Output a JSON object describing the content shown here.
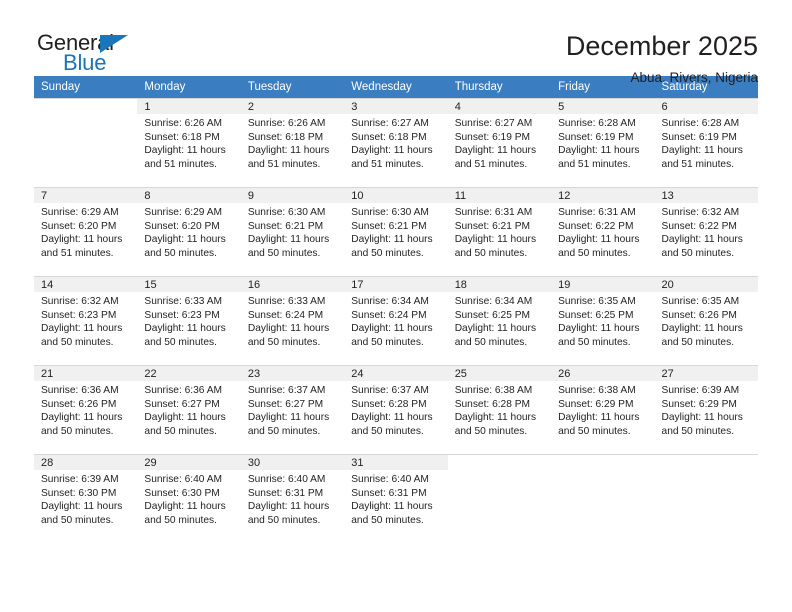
{
  "brand": {
    "name_part1": "General",
    "name_part2": "Blue",
    "triangle_color": "#1b75bb",
    "text_color": "#231f20"
  },
  "header": {
    "title": "December 2025",
    "subtitle": "Abua, Rivers, Nigeria",
    "header_bg": "#3a7dc0",
    "header_text": "#ffffff",
    "daynum_band_bg": "#f0f0f0"
  },
  "weekday_headers": [
    "Sunday",
    "Monday",
    "Tuesday",
    "Wednesday",
    "Thursday",
    "Friday",
    "Saturday"
  ],
  "weeks": [
    [
      {
        "day": "",
        "sunrise": "",
        "sunset": "",
        "daylight1": "",
        "daylight2": ""
      },
      {
        "day": "1",
        "sunrise": "Sunrise: 6:26 AM",
        "sunset": "Sunset: 6:18 PM",
        "daylight1": "Daylight: 11 hours",
        "daylight2": "and 51 minutes."
      },
      {
        "day": "2",
        "sunrise": "Sunrise: 6:26 AM",
        "sunset": "Sunset: 6:18 PM",
        "daylight1": "Daylight: 11 hours",
        "daylight2": "and 51 minutes."
      },
      {
        "day": "3",
        "sunrise": "Sunrise: 6:27 AM",
        "sunset": "Sunset: 6:18 PM",
        "daylight1": "Daylight: 11 hours",
        "daylight2": "and 51 minutes."
      },
      {
        "day": "4",
        "sunrise": "Sunrise: 6:27 AM",
        "sunset": "Sunset: 6:19 PM",
        "daylight1": "Daylight: 11 hours",
        "daylight2": "and 51 minutes."
      },
      {
        "day": "5",
        "sunrise": "Sunrise: 6:28 AM",
        "sunset": "Sunset: 6:19 PM",
        "daylight1": "Daylight: 11 hours",
        "daylight2": "and 51 minutes."
      },
      {
        "day": "6",
        "sunrise": "Sunrise: 6:28 AM",
        "sunset": "Sunset: 6:19 PM",
        "daylight1": "Daylight: 11 hours",
        "daylight2": "and 51 minutes."
      }
    ],
    [
      {
        "day": "7",
        "sunrise": "Sunrise: 6:29 AM",
        "sunset": "Sunset: 6:20 PM",
        "daylight1": "Daylight: 11 hours",
        "daylight2": "and 51 minutes."
      },
      {
        "day": "8",
        "sunrise": "Sunrise: 6:29 AM",
        "sunset": "Sunset: 6:20 PM",
        "daylight1": "Daylight: 11 hours",
        "daylight2": "and 50 minutes."
      },
      {
        "day": "9",
        "sunrise": "Sunrise: 6:30 AM",
        "sunset": "Sunset: 6:21 PM",
        "daylight1": "Daylight: 11 hours",
        "daylight2": "and 50 minutes."
      },
      {
        "day": "10",
        "sunrise": "Sunrise: 6:30 AM",
        "sunset": "Sunset: 6:21 PM",
        "daylight1": "Daylight: 11 hours",
        "daylight2": "and 50 minutes."
      },
      {
        "day": "11",
        "sunrise": "Sunrise: 6:31 AM",
        "sunset": "Sunset: 6:21 PM",
        "daylight1": "Daylight: 11 hours",
        "daylight2": "and 50 minutes."
      },
      {
        "day": "12",
        "sunrise": "Sunrise: 6:31 AM",
        "sunset": "Sunset: 6:22 PM",
        "daylight1": "Daylight: 11 hours",
        "daylight2": "and 50 minutes."
      },
      {
        "day": "13",
        "sunrise": "Sunrise: 6:32 AM",
        "sunset": "Sunset: 6:22 PM",
        "daylight1": "Daylight: 11 hours",
        "daylight2": "and 50 minutes."
      }
    ],
    [
      {
        "day": "14",
        "sunrise": "Sunrise: 6:32 AM",
        "sunset": "Sunset: 6:23 PM",
        "daylight1": "Daylight: 11 hours",
        "daylight2": "and 50 minutes."
      },
      {
        "day": "15",
        "sunrise": "Sunrise: 6:33 AM",
        "sunset": "Sunset: 6:23 PM",
        "daylight1": "Daylight: 11 hours",
        "daylight2": "and 50 minutes."
      },
      {
        "day": "16",
        "sunrise": "Sunrise: 6:33 AM",
        "sunset": "Sunset: 6:24 PM",
        "daylight1": "Daylight: 11 hours",
        "daylight2": "and 50 minutes."
      },
      {
        "day": "17",
        "sunrise": "Sunrise: 6:34 AM",
        "sunset": "Sunset: 6:24 PM",
        "daylight1": "Daylight: 11 hours",
        "daylight2": "and 50 minutes."
      },
      {
        "day": "18",
        "sunrise": "Sunrise: 6:34 AM",
        "sunset": "Sunset: 6:25 PM",
        "daylight1": "Daylight: 11 hours",
        "daylight2": "and 50 minutes."
      },
      {
        "day": "19",
        "sunrise": "Sunrise: 6:35 AM",
        "sunset": "Sunset: 6:25 PM",
        "daylight1": "Daylight: 11 hours",
        "daylight2": "and 50 minutes."
      },
      {
        "day": "20",
        "sunrise": "Sunrise: 6:35 AM",
        "sunset": "Sunset: 6:26 PM",
        "daylight1": "Daylight: 11 hours",
        "daylight2": "and 50 minutes."
      }
    ],
    [
      {
        "day": "21",
        "sunrise": "Sunrise: 6:36 AM",
        "sunset": "Sunset: 6:26 PM",
        "daylight1": "Daylight: 11 hours",
        "daylight2": "and 50 minutes."
      },
      {
        "day": "22",
        "sunrise": "Sunrise: 6:36 AM",
        "sunset": "Sunset: 6:27 PM",
        "daylight1": "Daylight: 11 hours",
        "daylight2": "and 50 minutes."
      },
      {
        "day": "23",
        "sunrise": "Sunrise: 6:37 AM",
        "sunset": "Sunset: 6:27 PM",
        "daylight1": "Daylight: 11 hours",
        "daylight2": "and 50 minutes."
      },
      {
        "day": "24",
        "sunrise": "Sunrise: 6:37 AM",
        "sunset": "Sunset: 6:28 PM",
        "daylight1": "Daylight: 11 hours",
        "daylight2": "and 50 minutes."
      },
      {
        "day": "25",
        "sunrise": "Sunrise: 6:38 AM",
        "sunset": "Sunset: 6:28 PM",
        "daylight1": "Daylight: 11 hours",
        "daylight2": "and 50 minutes."
      },
      {
        "day": "26",
        "sunrise": "Sunrise: 6:38 AM",
        "sunset": "Sunset: 6:29 PM",
        "daylight1": "Daylight: 11 hours",
        "daylight2": "and 50 minutes."
      },
      {
        "day": "27",
        "sunrise": "Sunrise: 6:39 AM",
        "sunset": "Sunset: 6:29 PM",
        "daylight1": "Daylight: 11 hours",
        "daylight2": "and 50 minutes."
      }
    ],
    [
      {
        "day": "28",
        "sunrise": "Sunrise: 6:39 AM",
        "sunset": "Sunset: 6:30 PM",
        "daylight1": "Daylight: 11 hours",
        "daylight2": "and 50 minutes."
      },
      {
        "day": "29",
        "sunrise": "Sunrise: 6:40 AM",
        "sunset": "Sunset: 6:30 PM",
        "daylight1": "Daylight: 11 hours",
        "daylight2": "and 50 minutes."
      },
      {
        "day": "30",
        "sunrise": "Sunrise: 6:40 AM",
        "sunset": "Sunset: 6:31 PM",
        "daylight1": "Daylight: 11 hours",
        "daylight2": "and 50 minutes."
      },
      {
        "day": "31",
        "sunrise": "Sunrise: 6:40 AM",
        "sunset": "Sunset: 6:31 PM",
        "daylight1": "Daylight: 11 hours",
        "daylight2": "and 50 minutes."
      },
      {
        "day": "",
        "sunrise": "",
        "sunset": "",
        "daylight1": "",
        "daylight2": ""
      },
      {
        "day": "",
        "sunrise": "",
        "sunset": "",
        "daylight1": "",
        "daylight2": ""
      },
      {
        "day": "",
        "sunrise": "",
        "sunset": "",
        "daylight1": "",
        "daylight2": ""
      }
    ]
  ]
}
